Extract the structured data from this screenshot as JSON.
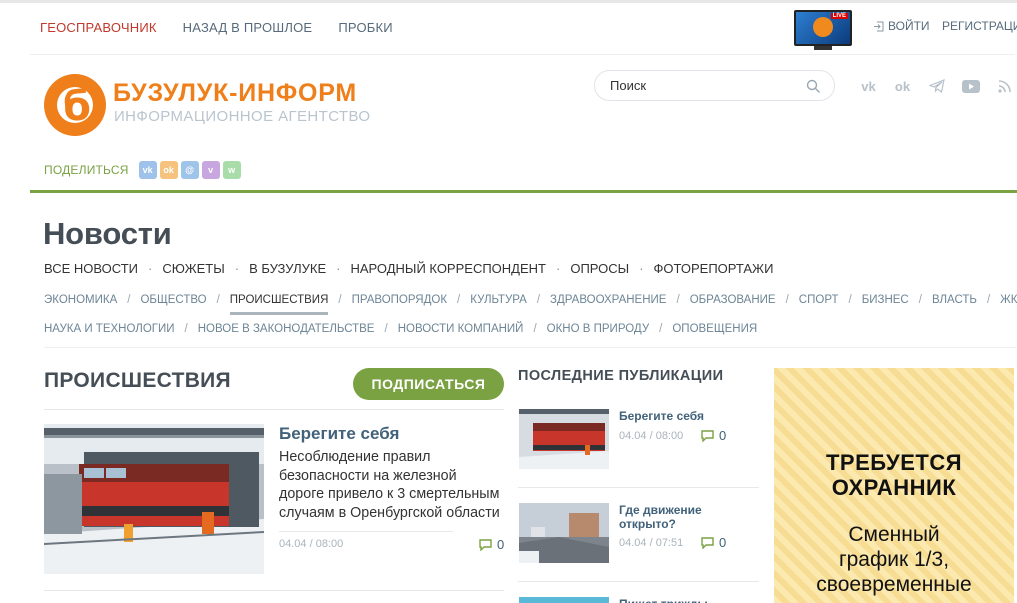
{
  "topnav": {
    "geo": "ГЕОСПРАВОЧНИК",
    "past": "НАЗАД В ПРОШЛОЕ",
    "traffic": "ПРОБКИ"
  },
  "live_badge": "LIVE",
  "auth": {
    "login": "ВОЙТИ",
    "register": "РЕГИСТРАЦИЯ"
  },
  "brand": {
    "name": "БУЗУЛУК-ИНФОРМ",
    "tagline": "ИНФОРМАЦИОННОЕ АГЕНТСТВО",
    "color": "#ef7f1a"
  },
  "search": {
    "placeholder": "Поиск"
  },
  "socials": [
    "vk-icon",
    "odnoklassniki-icon",
    "telegram-icon",
    "youtube-icon",
    "rss-icon"
  ],
  "share": {
    "label": "ПОДЕЛИТЬСЯ",
    "buttons": [
      {
        "icon": "vk-icon",
        "color": "#9ec2ea"
      },
      {
        "icon": "odnoklassniki-icon",
        "color": "#f5c37e"
      },
      {
        "icon": "moimir-icon",
        "color": "#9fc4ea"
      },
      {
        "icon": "viber-icon",
        "color": "#c8a6e0"
      },
      {
        "icon": "whatsapp-icon",
        "color": "#a8dca8"
      }
    ]
  },
  "page_title": "Новости",
  "main_nav": [
    "ВСЕ НОВОСТИ",
    "СЮЖЕТЫ",
    "В БУЗУЛУКЕ",
    "НАРОДНЫЙ КОРРЕСПОНДЕНТ",
    "ОПРОСЫ",
    "ФОТОРЕПОРТАЖИ"
  ],
  "categories_row1": [
    "ЭКОНОМИКА",
    "ОБЩЕСТВО",
    "ПРОИСШЕСТВИЯ",
    "ПРАВОПОРЯДОК",
    "КУЛЬТУРА",
    "ЗДРАВООХРАНЕНИЕ",
    "ОБРАЗОВАНИЕ",
    "СПОРТ",
    "БИЗНЕС",
    "ВЛАСТЬ",
    "ЖКХ"
  ],
  "categories_row2": [
    "НАУКА И ТЕХНОЛОГИИ",
    "НОВОЕ В ЗАКОНОДАТЕЛЬСТВЕ",
    "НОВОСТИ КОМПАНИЙ",
    "ОКНО В ПРИРОДУ",
    "ОПОВЕЩЕНИЯ"
  ],
  "active_category": "ПРОИСШЕСТВИЯ",
  "section": {
    "title": "ПРОИСШЕСТВИЯ",
    "subscribe": "ПОДПИСАТЬСЯ"
  },
  "main_article": {
    "title": "Берегите себя",
    "lead": "Несоблюдение правил безопасности на железной дороге привело к 3 смертельным случаям в Оренбургской области",
    "date": "04.04 / 08:00",
    "comments": "0"
  },
  "latest": {
    "title": "ПОСЛЕДНИЕ ПУБЛИКАЦИИ",
    "items": [
      {
        "title": "Берегите себя",
        "date": "04.04 / 08:00",
        "comments": "0"
      },
      {
        "title": "Где движение открыто?",
        "date": "04.04 / 07:51",
        "comments": "0"
      },
      {
        "title": "Пишет трижды почетно-за"
      }
    ]
  },
  "banner": {
    "line1": "ТРЕБУЕТСЯ",
    "line2": "ОХРАННИК",
    "line3": "Сменный",
    "line4": "график 1/3,",
    "line5": "своевременные"
  },
  "colors": {
    "accent_green": "#7aa243",
    "link_blue": "#41627a",
    "nav_red": "#c0392b"
  }
}
